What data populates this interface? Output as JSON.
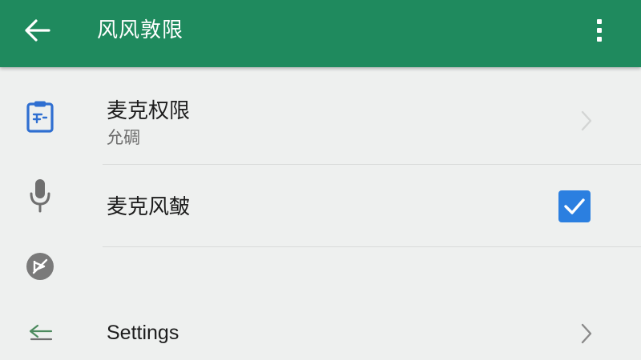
{
  "appbar": {
    "title": "风风敦限",
    "back_icon": "arrow-left-icon",
    "more_icon": "more-vertical-icon",
    "color": "#1f8a5e"
  },
  "rows": [
    {
      "icon": "clipboard-icon",
      "primary": "麦克权限",
      "secondary": "允碉"
    },
    {
      "icon": "microphone-icon",
      "primary": "麦克风皶",
      "checked": true
    },
    {
      "icon": "no-sound-icon"
    },
    {
      "icon": "arrow-left-icon",
      "primary": "Settings"
    }
  ],
  "colors": {
    "checkbox": "#2b7fe0",
    "clipboard_icon": "#2f6fd1",
    "background": "#eef0ef"
  }
}
